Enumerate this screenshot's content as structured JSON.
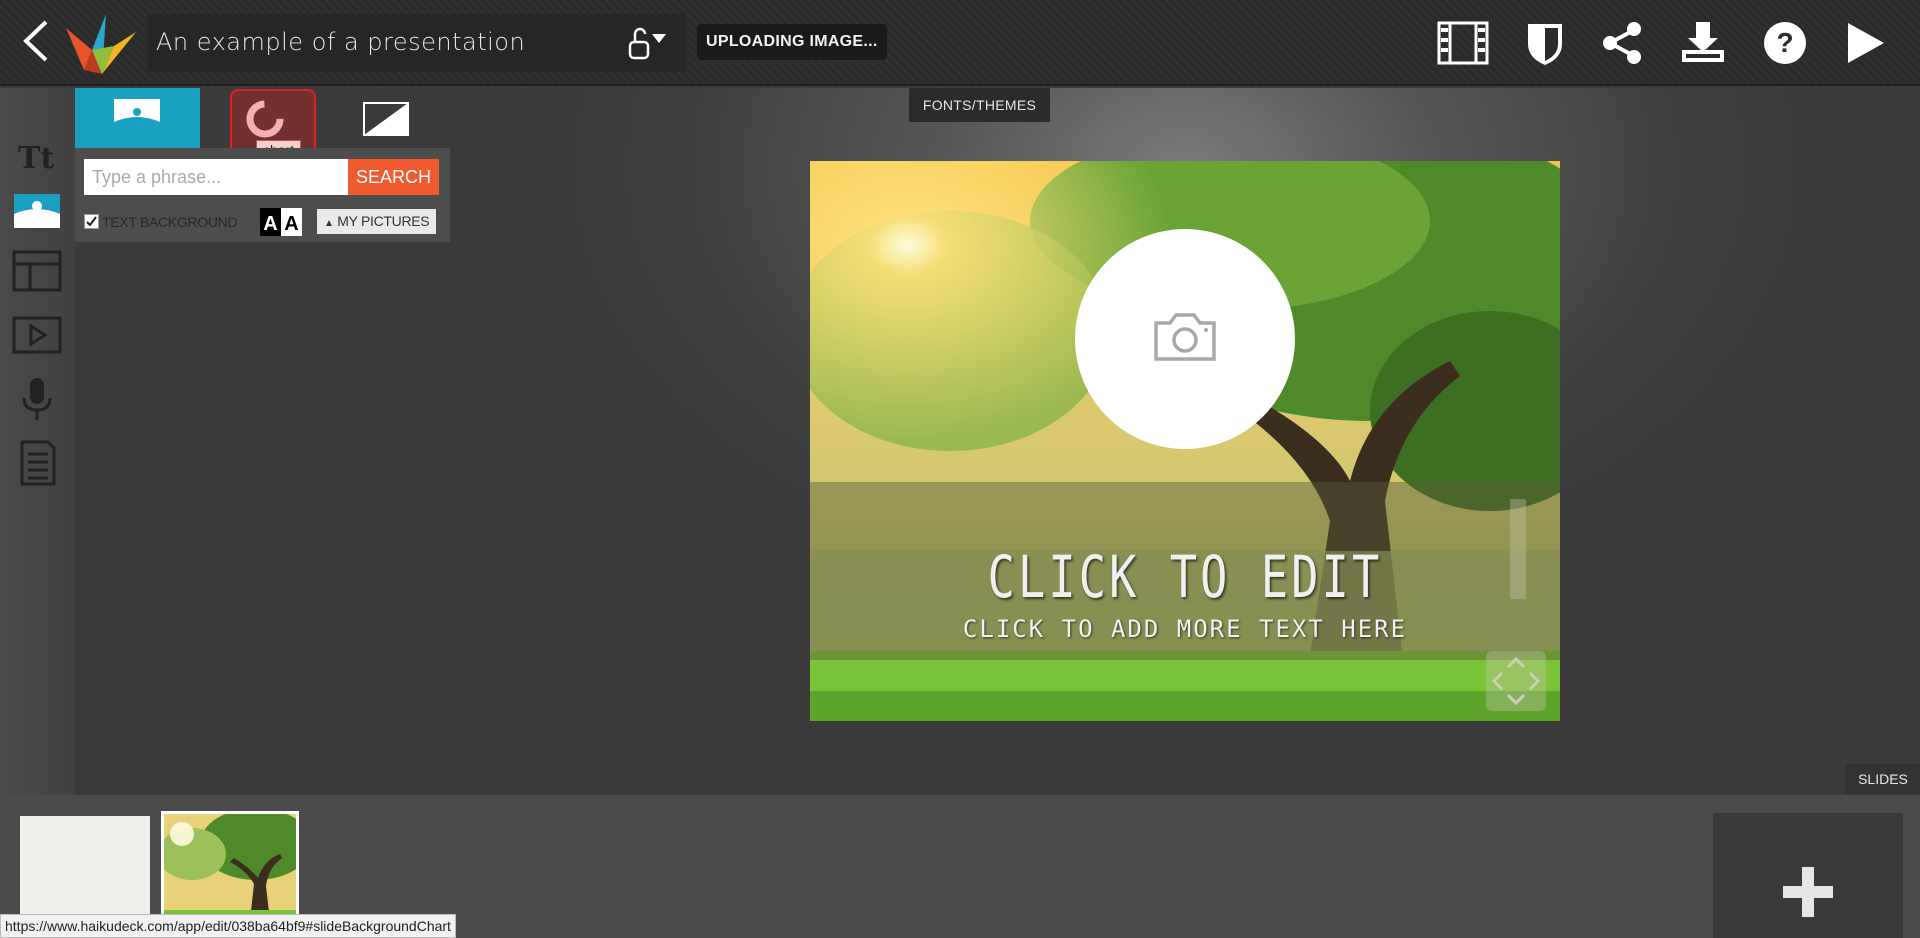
{
  "header": {
    "title": "An example of a presentation",
    "status": "UPLOADING IMAGE..."
  },
  "icons": {
    "back": "chevron-left-icon",
    "logo": "haiku-deck-logo",
    "lock": "unlock-icon",
    "film": "film-icon",
    "shield": "shield-icon",
    "share": "share-icon",
    "download": "download-icon",
    "help": "help-icon",
    "play": "play-icon"
  },
  "panel": {
    "search_placeholder": "Type a phrase...",
    "search_button": "SEARCH",
    "text_background_label": "TEXT BACKGROUND",
    "my_pictures_label": "MY PICTURES",
    "aa_label": "AA",
    "tooltip": "chart"
  },
  "stage": {
    "fonts_tab": "FONTS/THEMES",
    "slide_title": "CLICK TO EDIT",
    "slide_subtitle": "CLICK TO ADD MORE TEXT HERE"
  },
  "slides": {
    "tab_label": "SLIDES"
  },
  "status_bar": {
    "url": "https://www.haikudeck.com/app/edit/038ba64bf9#slideBackgroundChart"
  },
  "colors": {
    "accent_tab": "#1aa0c0",
    "search_button": "#ef5a2f",
    "highlight": "#e02020"
  }
}
